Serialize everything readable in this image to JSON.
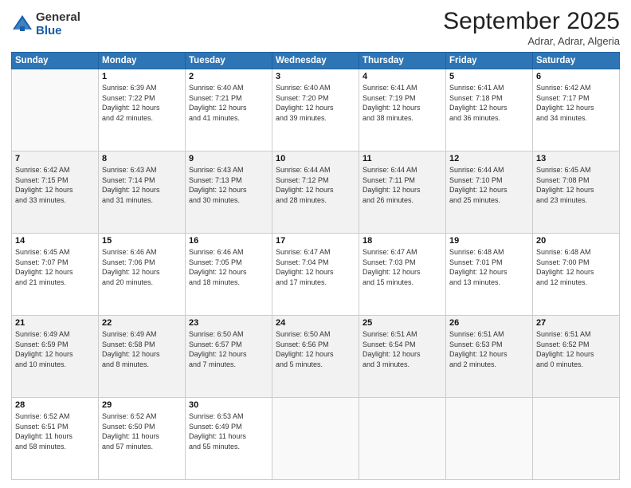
{
  "logo": {
    "general": "General",
    "blue": "Blue"
  },
  "header": {
    "title": "September 2025",
    "subtitle": "Adrar, Adrar, Algeria"
  },
  "weekdays": [
    "Sunday",
    "Monday",
    "Tuesday",
    "Wednesday",
    "Thursday",
    "Friday",
    "Saturday"
  ],
  "weeks": [
    [
      {
        "day": "",
        "text": ""
      },
      {
        "day": "1",
        "text": "Sunrise: 6:39 AM\nSunset: 7:22 PM\nDaylight: 12 hours\nand 42 minutes."
      },
      {
        "day": "2",
        "text": "Sunrise: 6:40 AM\nSunset: 7:21 PM\nDaylight: 12 hours\nand 41 minutes."
      },
      {
        "day": "3",
        "text": "Sunrise: 6:40 AM\nSunset: 7:20 PM\nDaylight: 12 hours\nand 39 minutes."
      },
      {
        "day": "4",
        "text": "Sunrise: 6:41 AM\nSunset: 7:19 PM\nDaylight: 12 hours\nand 38 minutes."
      },
      {
        "day": "5",
        "text": "Sunrise: 6:41 AM\nSunset: 7:18 PM\nDaylight: 12 hours\nand 36 minutes."
      },
      {
        "day": "6",
        "text": "Sunrise: 6:42 AM\nSunset: 7:17 PM\nDaylight: 12 hours\nand 34 minutes."
      }
    ],
    [
      {
        "day": "7",
        "text": "Sunrise: 6:42 AM\nSunset: 7:15 PM\nDaylight: 12 hours\nand 33 minutes."
      },
      {
        "day": "8",
        "text": "Sunrise: 6:43 AM\nSunset: 7:14 PM\nDaylight: 12 hours\nand 31 minutes."
      },
      {
        "day": "9",
        "text": "Sunrise: 6:43 AM\nSunset: 7:13 PM\nDaylight: 12 hours\nand 30 minutes."
      },
      {
        "day": "10",
        "text": "Sunrise: 6:44 AM\nSunset: 7:12 PM\nDaylight: 12 hours\nand 28 minutes."
      },
      {
        "day": "11",
        "text": "Sunrise: 6:44 AM\nSunset: 7:11 PM\nDaylight: 12 hours\nand 26 minutes."
      },
      {
        "day": "12",
        "text": "Sunrise: 6:44 AM\nSunset: 7:10 PM\nDaylight: 12 hours\nand 25 minutes."
      },
      {
        "day": "13",
        "text": "Sunrise: 6:45 AM\nSunset: 7:08 PM\nDaylight: 12 hours\nand 23 minutes."
      }
    ],
    [
      {
        "day": "14",
        "text": "Sunrise: 6:45 AM\nSunset: 7:07 PM\nDaylight: 12 hours\nand 21 minutes."
      },
      {
        "day": "15",
        "text": "Sunrise: 6:46 AM\nSunset: 7:06 PM\nDaylight: 12 hours\nand 20 minutes."
      },
      {
        "day": "16",
        "text": "Sunrise: 6:46 AM\nSunset: 7:05 PM\nDaylight: 12 hours\nand 18 minutes."
      },
      {
        "day": "17",
        "text": "Sunrise: 6:47 AM\nSunset: 7:04 PM\nDaylight: 12 hours\nand 17 minutes."
      },
      {
        "day": "18",
        "text": "Sunrise: 6:47 AM\nSunset: 7:03 PM\nDaylight: 12 hours\nand 15 minutes."
      },
      {
        "day": "19",
        "text": "Sunrise: 6:48 AM\nSunset: 7:01 PM\nDaylight: 12 hours\nand 13 minutes."
      },
      {
        "day": "20",
        "text": "Sunrise: 6:48 AM\nSunset: 7:00 PM\nDaylight: 12 hours\nand 12 minutes."
      }
    ],
    [
      {
        "day": "21",
        "text": "Sunrise: 6:49 AM\nSunset: 6:59 PM\nDaylight: 12 hours\nand 10 minutes."
      },
      {
        "day": "22",
        "text": "Sunrise: 6:49 AM\nSunset: 6:58 PM\nDaylight: 12 hours\nand 8 minutes."
      },
      {
        "day": "23",
        "text": "Sunrise: 6:50 AM\nSunset: 6:57 PM\nDaylight: 12 hours\nand 7 minutes."
      },
      {
        "day": "24",
        "text": "Sunrise: 6:50 AM\nSunset: 6:56 PM\nDaylight: 12 hours\nand 5 minutes."
      },
      {
        "day": "25",
        "text": "Sunrise: 6:51 AM\nSunset: 6:54 PM\nDaylight: 12 hours\nand 3 minutes."
      },
      {
        "day": "26",
        "text": "Sunrise: 6:51 AM\nSunset: 6:53 PM\nDaylight: 12 hours\nand 2 minutes."
      },
      {
        "day": "27",
        "text": "Sunrise: 6:51 AM\nSunset: 6:52 PM\nDaylight: 12 hours\nand 0 minutes."
      }
    ],
    [
      {
        "day": "28",
        "text": "Sunrise: 6:52 AM\nSunset: 6:51 PM\nDaylight: 11 hours\nand 58 minutes."
      },
      {
        "day": "29",
        "text": "Sunrise: 6:52 AM\nSunset: 6:50 PM\nDaylight: 11 hours\nand 57 minutes."
      },
      {
        "day": "30",
        "text": "Sunrise: 6:53 AM\nSunset: 6:49 PM\nDaylight: 11 hours\nand 55 minutes."
      },
      {
        "day": "",
        "text": ""
      },
      {
        "day": "",
        "text": ""
      },
      {
        "day": "",
        "text": ""
      },
      {
        "day": "",
        "text": ""
      }
    ]
  ]
}
